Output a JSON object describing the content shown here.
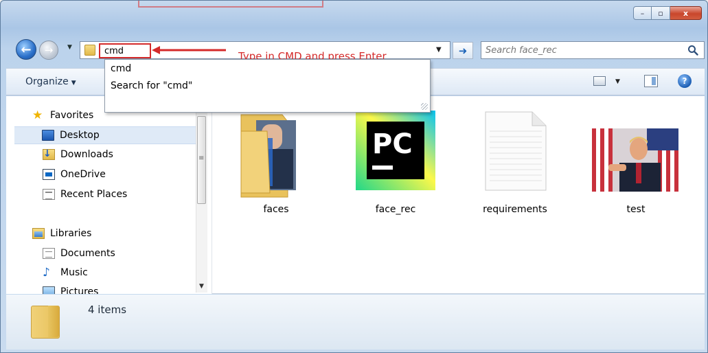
{
  "window": {
    "close_label": "x",
    "min_label": "–",
    "max_label": "▫"
  },
  "address_bar": {
    "value": "cmd",
    "dropdown_glyph": "▼"
  },
  "search": {
    "placeholder": "Search face_rec"
  },
  "annotation": {
    "text": "Type in CMD and press Enter",
    "color": "#d42a2a"
  },
  "suggestions": {
    "items": [
      "cmd",
      "Search for \"cmd\""
    ]
  },
  "toolbar": {
    "organize_label": "Organize",
    "help_label": "?"
  },
  "sidebar": {
    "favorites_label": "Favorites",
    "items": [
      "Desktop",
      "Downloads",
      "OneDrive",
      "Recent Places"
    ],
    "libraries_label": "Libraries",
    "library_items": [
      "Documents",
      "Music",
      "Pictures"
    ]
  },
  "files": [
    {
      "name": "faces",
      "icon": "folder-icon"
    },
    {
      "name": "face_rec",
      "icon": "pycharm-icon"
    },
    {
      "name": "requirements",
      "icon": "text-file-icon"
    },
    {
      "name": "test",
      "icon": "image-thumbnail"
    }
  ],
  "pycharm_logo_text": "PC",
  "status": {
    "item_count": "4 items"
  }
}
